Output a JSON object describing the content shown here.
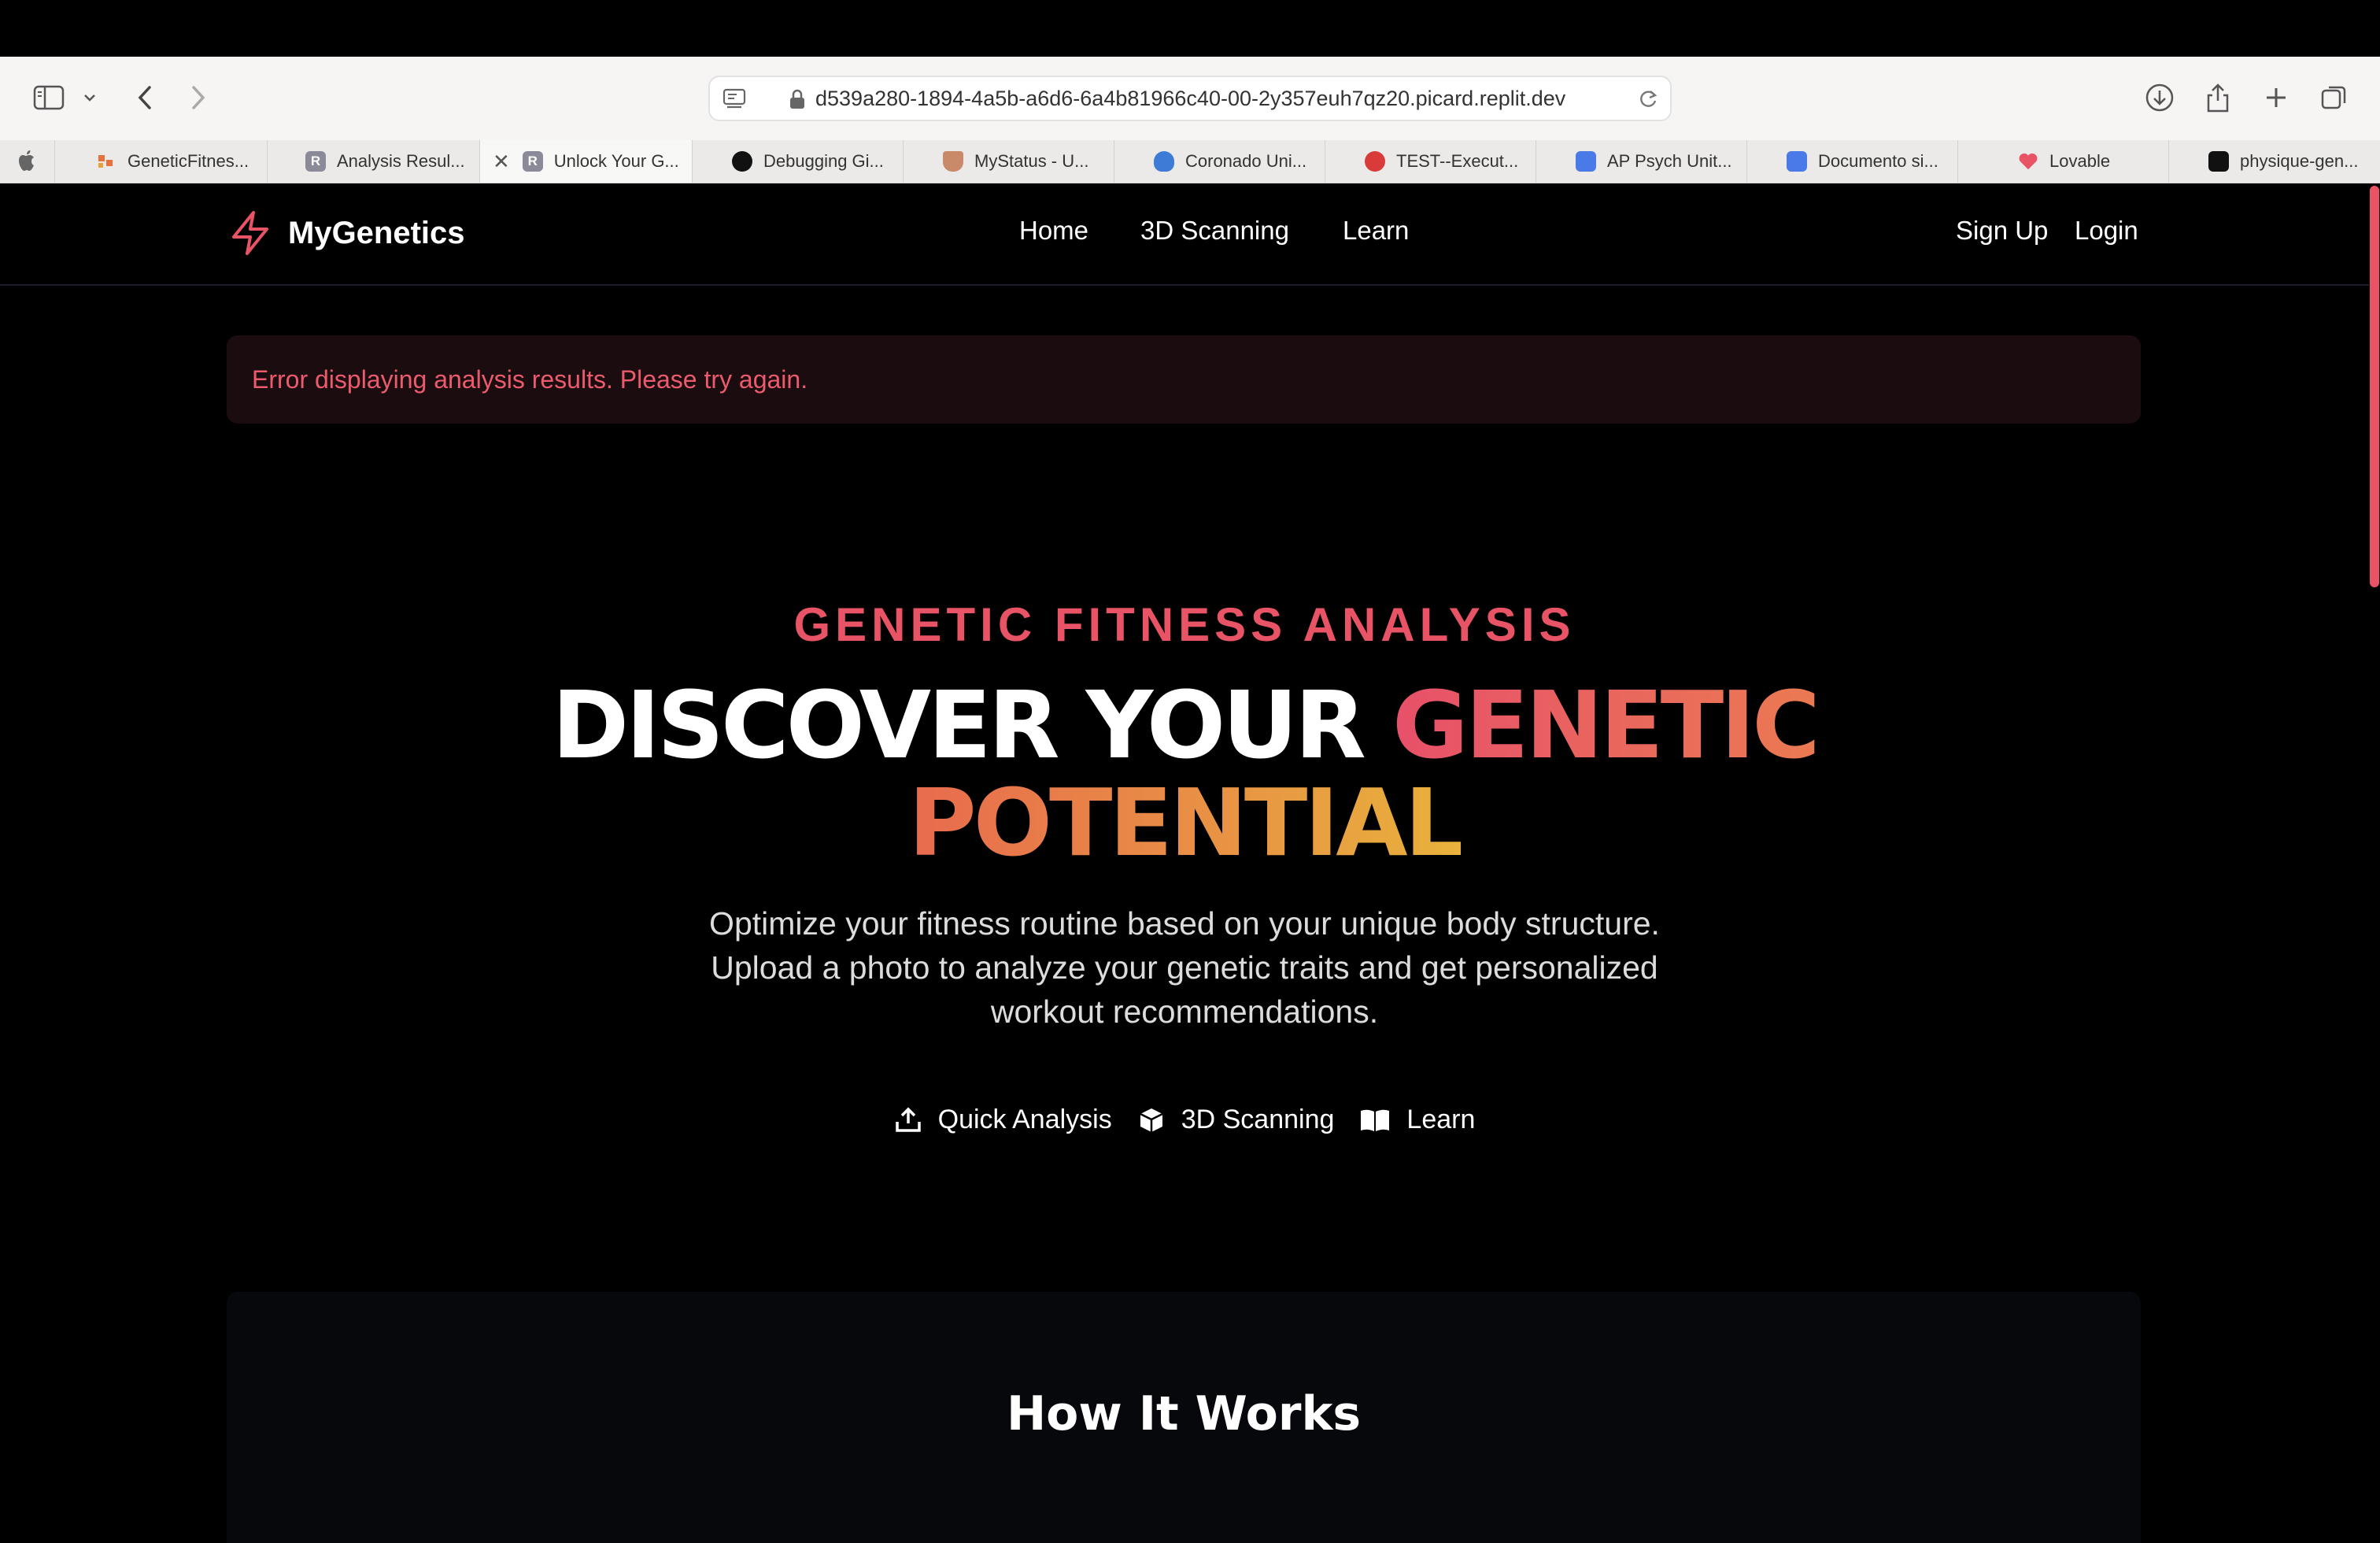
{
  "browser": {
    "url": "d539a280-1894-4a5b-a6d6-6a4b81966c40-00-2y357euh7qz20.picard.replit.dev",
    "tabs": [
      {
        "label": "GeneticFitnes...",
        "favicon_color": "#e8703a",
        "favicon_letter": ""
      },
      {
        "label": "Analysis Resul...",
        "favicon_color": "#8a8a99",
        "favicon_letter": "R"
      },
      {
        "label": "Unlock Your G...",
        "favicon_color": "#8a8a99",
        "favicon_letter": "R"
      },
      {
        "label": "Debugging Gi...",
        "favicon_color": "#111111",
        "favicon_letter": ""
      },
      {
        "label": "MyStatus - U...",
        "favicon_color": "#c98a6a",
        "favicon_letter": ""
      },
      {
        "label": "Coronado Uni...",
        "favicon_color": "#3d7bd6",
        "favicon_letter": ""
      },
      {
        "label": "TEST--Execut...",
        "favicon_color": "#d93a3a",
        "favicon_letter": ""
      },
      {
        "label": "AP Psych Unit...",
        "favicon_color": "#4a7ae8",
        "favicon_letter": ""
      },
      {
        "label": "Documento si...",
        "favicon_color": "#4a7ae8",
        "favicon_letter": ""
      },
      {
        "label": "Lovable",
        "favicon_color": "#e85466",
        "favicon_letter": ""
      },
      {
        "label": "physique-gen...",
        "favicon_color": "#111111",
        "favicon_letter": ""
      }
    ]
  },
  "nav": {
    "brand": "MyGenetics",
    "links": [
      "Home",
      "3D Scanning",
      "Learn"
    ],
    "sign_up": "Sign Up",
    "login": "Login"
  },
  "error_message": "Error displaying analysis results. Please try again.",
  "hero": {
    "eyebrow": "GENETIC FITNESS ANALYSIS",
    "headline_white": "DISCOVER YOUR ",
    "headline_accent": "GENETIC",
    "headline_line2": "POTENTIAL",
    "subtitle_lines": [
      "Optimize your fitness routine based on your unique body structure.",
      "Upload a photo to analyze your genetic traits and get personalized",
      "workout recommendations."
    ],
    "actions": [
      {
        "label": "Quick Analysis",
        "icon": "upload-icon"
      },
      {
        "label": "3D Scanning",
        "icon": "cube-icon"
      },
      {
        "label": "Learn",
        "icon": "book-icon"
      }
    ]
  },
  "section": {
    "title": "How It Works"
  },
  "colors": {
    "accent": "#e85466",
    "accent_orange": "#ea7a52",
    "accent_yellow": "#e8b23c"
  }
}
